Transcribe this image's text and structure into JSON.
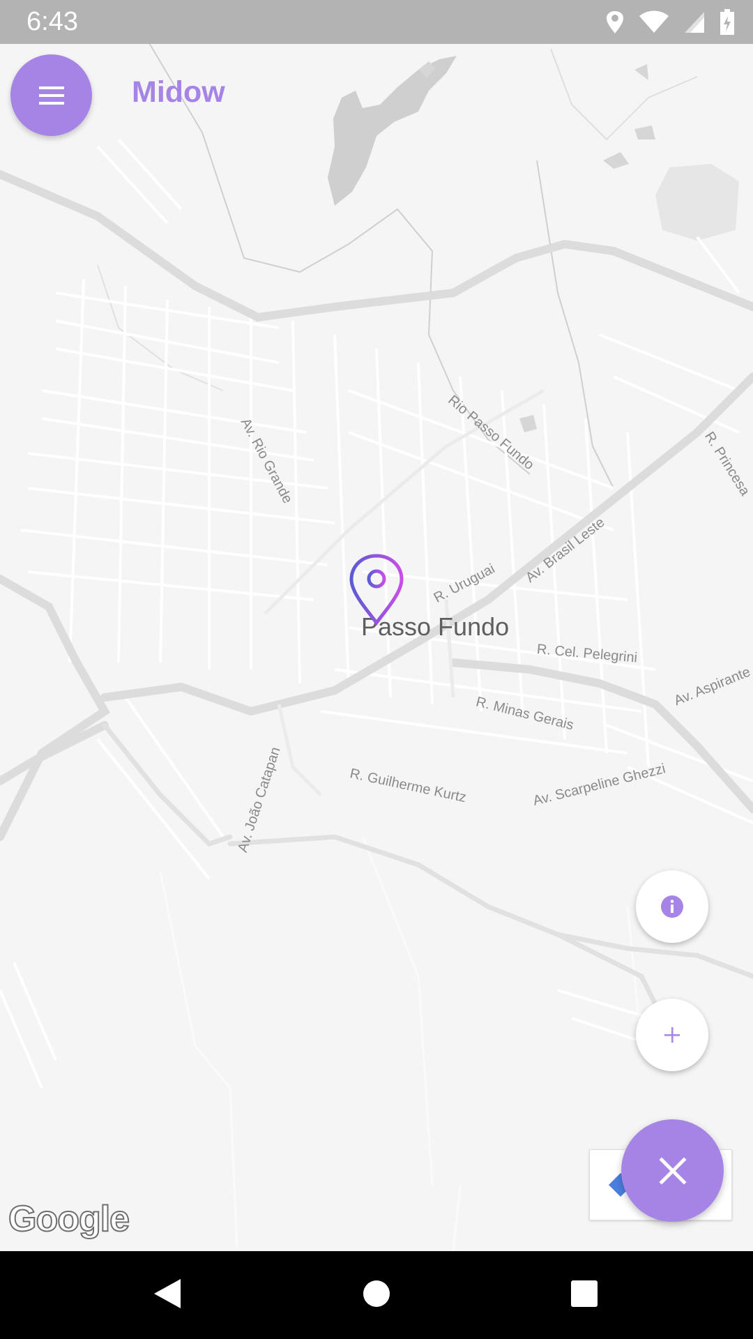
{
  "status_bar": {
    "time": "6:43",
    "icons": [
      "location-icon",
      "wifi-icon",
      "signal-icon",
      "battery-icon"
    ]
  },
  "header": {
    "app_title": "Midow",
    "menu_icon": "hamburger-menu-icon"
  },
  "map": {
    "city_label": "Passo Fundo",
    "street_labels": {
      "av_rio_grande": "Av. Rio Grande",
      "rio_passo_fundo": "Rio Passo Fundo",
      "r_princesa": "R. Princesa",
      "av_brasil_leste": "Av. Brasil Leste",
      "r_uruguai": "R. Uruguai",
      "r_cel_pelegrini": "R. Cel. Pelegrini",
      "av_aspirante": "Av. Aspirante J",
      "r_minas_gerais": "R. Minas Gerais",
      "r_guilherme_kurtz": "R. Guilherme Kurtz",
      "av_scarpeline_ghezzi": "Av. Scarpeline Ghezzi",
      "av_joao_catapan": "Av. João Catapan"
    },
    "attribution": "Google",
    "marker_icon": "location-pin-icon"
  },
  "fabs": {
    "info_icon": "info-icon",
    "add_label": "+",
    "close_icon": "close-icon"
  },
  "colors": {
    "accent": "#a584e6",
    "pin_gradient_start": "#5b5bd6",
    "pin_gradient_end": "#c84ee6",
    "status_bar": "#b3b3b3",
    "map_background": "#f5f5f5"
  },
  "nav_bar": {
    "buttons": [
      "back-icon",
      "home-icon",
      "recents-icon"
    ]
  }
}
